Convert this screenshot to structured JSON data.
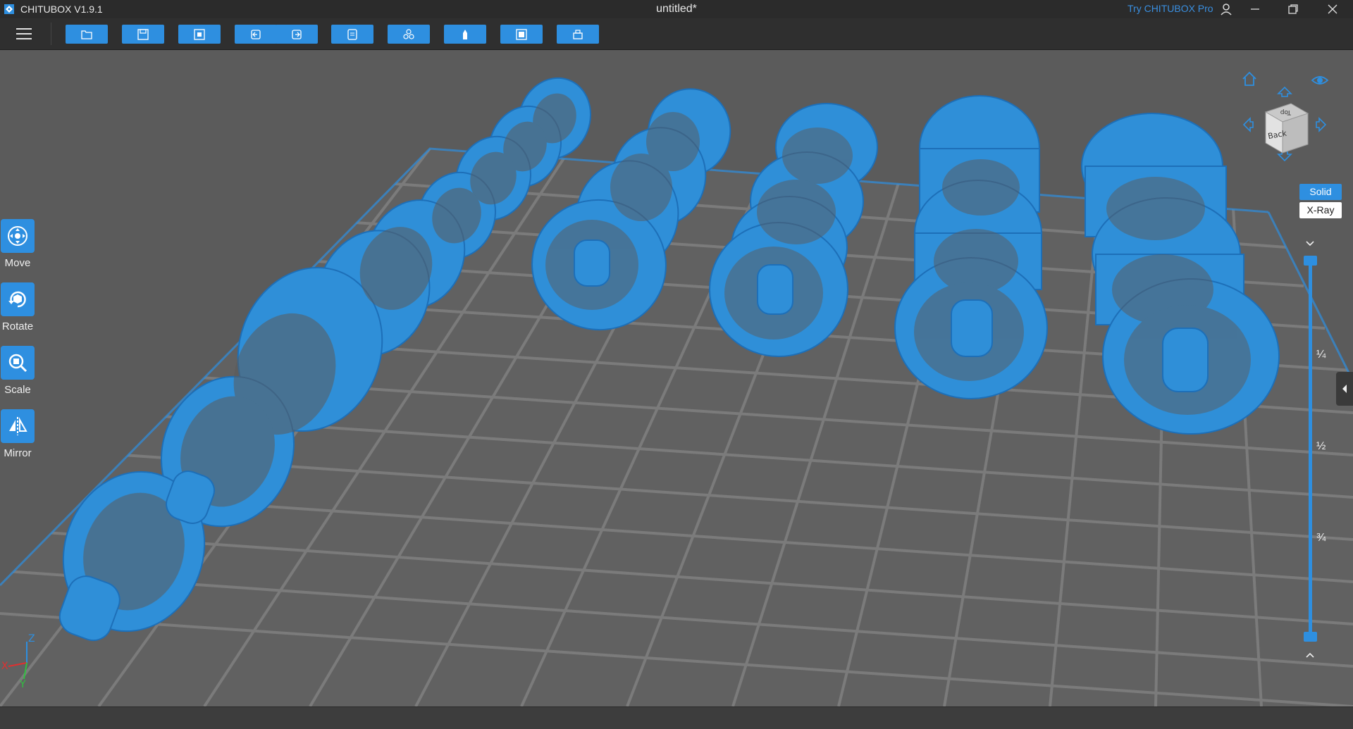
{
  "titlebar": {
    "app_name": "CHITUBOX V1.9.1",
    "document_title": "untitled*",
    "try_pro": "Try CHITUBOX Pro"
  },
  "toolbar": {
    "buttons": [
      {
        "name": "open-file",
        "icon": "folder-open-icon"
      },
      {
        "name": "save",
        "icon": "save-icon"
      },
      {
        "name": "import-model",
        "icon": "import-icon"
      },
      {
        "name": "undo",
        "icon": "undo-icon"
      },
      {
        "name": "redo",
        "icon": "redo-icon"
      },
      {
        "name": "model-list",
        "icon": "list-icon"
      },
      {
        "name": "arrange",
        "icon": "arrange-icon"
      },
      {
        "name": "support",
        "icon": "support-icon"
      },
      {
        "name": "hollow",
        "icon": "hollow-icon"
      },
      {
        "name": "print-settings",
        "icon": "printer-icon"
      }
    ]
  },
  "tools": {
    "move": "Move",
    "rotate": "Rotate",
    "scale": "Scale",
    "mirror": "Mirror"
  },
  "view": {
    "cube_top": "Top",
    "cube_back": "Back",
    "solid": "Solid",
    "xray": "X-Ray",
    "active_mode": "Solid"
  },
  "slider": {
    "ticks": [
      "¼",
      "½",
      "¾"
    ],
    "top_value": 1.0,
    "bottom_value": 0.0
  },
  "axes": {
    "x": "X",
    "y": "Y",
    "z": "Z"
  },
  "colors": {
    "accent": "#2e8fe0",
    "model": "#2f8fd8",
    "platform": "#5f5f5f",
    "grid": "#7a7a7a"
  }
}
